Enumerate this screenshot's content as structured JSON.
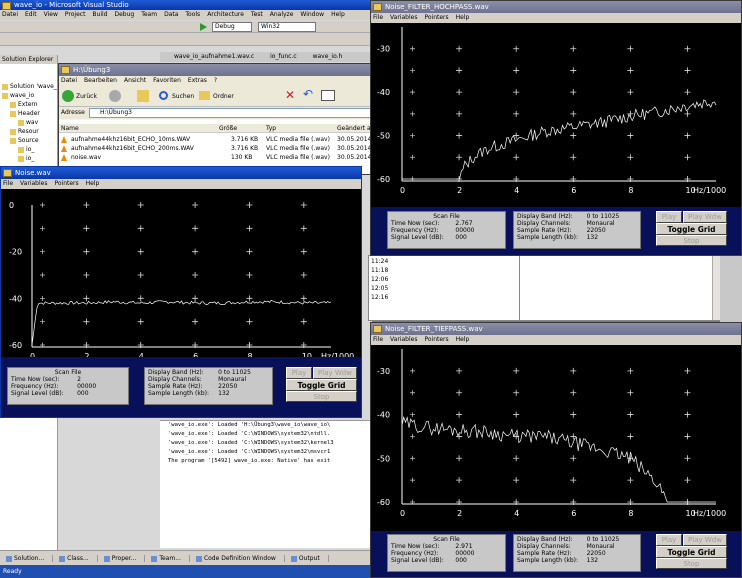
{
  "vs": {
    "title": "wave_io - Microsoft Visual Studio",
    "menu": [
      "Datei",
      "Edit",
      "View",
      "Project",
      "Build",
      "Debug",
      "Team",
      "Data",
      "Tools",
      "Architecture",
      "Test",
      "Analyze",
      "Window",
      "Help"
    ],
    "config": "Debug",
    "platform": "Win32",
    "doc_tabs": [
      "wave_io_aufnahme1.wav.c",
      "io_func.c",
      "wave_io.h"
    ],
    "solution_explorer_title": "Solution Explorer",
    "tree": [
      "Solution 'wave_",
      "wave_io",
      "Extern",
      "Header",
      "wav",
      "Resour",
      "Source",
      "io_",
      "io_"
    ],
    "output_lines": [
      "'wave_io.exe': Loaded 'H:\\Übung3\\wave_io\\wave_io\\",
      "'wave_io.exe': Loaded 'C:\\WINDOWS\\system32\\ntdll.",
      "'wave_io.exe': Loaded 'C:\\WINDOWS\\system32\\kernel3",
      "'wave_io.exe': Loaded 'C:\\WINDOWS\\system32\\msvcr1",
      "The program '[5492] wave_io.exe: Native' has exit"
    ],
    "taskbar": [
      "Solution...",
      "Class...",
      "Proper...",
      "Team...",
      "Code Definition Window",
      "Output"
    ],
    "middle_times": [
      "11:24",
      "11:18",
      "12:06",
      "12:05",
      "12:16"
    ],
    "status": "Ready"
  },
  "explorer": {
    "title": "H:\\Übung3",
    "menu": [
      "Datei",
      "Bearbeiten",
      "Ansicht",
      "Favoriten",
      "Extras",
      "?"
    ],
    "toolbar": {
      "back": "Zurück",
      "search": "Suchen",
      "folders": "Ordner"
    },
    "address_label": "Adresse",
    "address": "H:\\Übung3",
    "columns": [
      "Name",
      "Größe",
      "Typ",
      "Geändert am"
    ],
    "files": [
      {
        "name": "aufnahme44khz16bit_ECHO_10ms.WAV",
        "size": "3.716 KB",
        "type": "VLC media file (.wav)",
        "date": "30.05.2014"
      },
      {
        "name": "aufnahme44khz16bit_ECHO_200ms.WAV",
        "size": "3.716 KB",
        "type": "VLC media file (.wav)",
        "date": "30.05.2014"
      },
      {
        "name": "noise.wav",
        "size": "130 KB",
        "type": "VLC media file (.wav)",
        "date": "30.05.2014"
      }
    ]
  },
  "windows": {
    "noise": {
      "title": "Noise.wav",
      "menu": [
        "File",
        "Variables",
        "Pointers",
        "Help"
      ],
      "scan_title": "Scan File",
      "scan": [
        [
          "Time Now (sec):",
          "2"
        ],
        [
          "Frequency (Hz):",
          "00000"
        ],
        [
          "Signal Level (dB):",
          "000"
        ]
      ],
      "display": [
        [
          "Display Band (Hz):",
          "0 to 11025"
        ],
        [
          "Display Channels:",
          "Monaural"
        ],
        [
          "Sample Rate (Hz):",
          "22050"
        ],
        [
          "Sample Length (kb):",
          "132"
        ]
      ],
      "buttons": {
        "play": "Play",
        "play_wdw": "Play Wdw",
        "toggle": "Toggle Grid",
        "stop": "Stop"
      }
    },
    "hochpass": {
      "title": "Noise_FILTER_HOCHPASS.wav",
      "menu": [
        "File",
        "Variables",
        "Pointers",
        "Help"
      ],
      "scan_title": "Scan File",
      "scan": [
        [
          "Time Now (sec):",
          "2.767"
        ],
        [
          "Frequency (Hz):",
          "00000"
        ],
        [
          "Signal Level (dB):",
          "000"
        ]
      ],
      "display": [
        [
          "Display Band (Hz):",
          "0 to 11025"
        ],
        [
          "Display Channels:",
          "Monaural"
        ],
        [
          "Sample Rate (Hz):",
          "22050"
        ],
        [
          "Sample Length (kb):",
          "132"
        ]
      ],
      "buttons": {
        "play": "Play",
        "play_wdw": "Play Wdw",
        "toggle": "Toggle Grid",
        "stop": "Stop"
      }
    },
    "tiefpass": {
      "title": "Noise_FILTER_TIEFPASS.wav",
      "menu": [
        "File",
        "Variables",
        "Pointers",
        "Help"
      ],
      "scan_title": "Scan File",
      "scan": [
        [
          "Time Now (sec):",
          "2.971"
        ],
        [
          "Frequency (Hz):",
          "00000"
        ],
        [
          "Signal Level (dB):",
          "000"
        ]
      ],
      "display": [
        [
          "Display Band (Hz):",
          "0 to 11025"
        ],
        [
          "Display Channels:",
          "Monaural"
        ],
        [
          "Sample Rate (Hz):",
          "22050"
        ],
        [
          "Sample Length (kb):",
          "132"
        ]
      ],
      "buttons": {
        "play": "Play",
        "play_wdw": "Play Wdw",
        "toggle": "Toggle Grid",
        "stop": "Stop"
      }
    }
  },
  "chart_data": [
    {
      "type": "line",
      "xlabel": "Hz/1000",
      "x_ticks": [
        "0",
        "2",
        "4",
        "6",
        "8",
        "10"
      ],
      "y_ticks": [
        "0",
        "-20",
        "-40",
        "-60"
      ],
      "ylim": [
        -60,
        0
      ],
      "xlim": [
        0,
        11
      ],
      "grid": true,
      "series": [
        {
          "x": [
            0,
            0.2,
            1,
            2,
            3,
            4,
            5,
            6,
            7,
            8,
            9,
            10,
            11
          ],
          "values": [
            -60,
            -42,
            -42,
            -42,
            -41.5,
            -42,
            -41.5,
            -42,
            -42,
            -41.5,
            -41.5,
            -42,
            -42
          ]
        }
      ]
    },
    {
      "type": "line",
      "xlabel": "Hz/1000",
      "x_ticks": [
        "0",
        "2",
        "4",
        "6",
        "8",
        "10"
      ],
      "y_ticks": [
        "-30",
        "-40",
        "-50",
        "-60"
      ],
      "ylim": [
        -60,
        -25
      ],
      "xlim": [
        0,
        11
      ],
      "grid": true,
      "series": [
        {
          "x": [
            0,
            1,
            2,
            2.2,
            2.5,
            3,
            4,
            5,
            6,
            7,
            8,
            9,
            10,
            11
          ],
          "values": [
            -60,
            -60,
            -60,
            -57,
            -55,
            -53,
            -51,
            -49,
            -48,
            -47,
            -45.5,
            -44.5,
            -43,
            -42
          ]
        }
      ]
    },
    {
      "type": "line",
      "xlabel": "Hz/1000",
      "x_ticks": [
        "0",
        "2",
        "4",
        "6",
        "8",
        "10"
      ],
      "y_ticks": [
        "-30",
        "-40",
        "-50",
        "-60"
      ],
      "ylim": [
        -60,
        -25
      ],
      "xlim": [
        0,
        11
      ],
      "grid": true,
      "series": [
        {
          "x": [
            0,
            1,
            2,
            3,
            4,
            5,
            6,
            7,
            8,
            9,
            9.3,
            10,
            11
          ],
          "values": [
            -42,
            -43,
            -43.5,
            -44,
            -45,
            -45,
            -46.5,
            -48,
            -50,
            -56,
            -60,
            -60,
            -60
          ]
        }
      ]
    }
  ],
  "colors": {
    "title_active": "#0a37a8",
    "plot_bg": "#000000",
    "panel_bg": "#08105a"
  }
}
